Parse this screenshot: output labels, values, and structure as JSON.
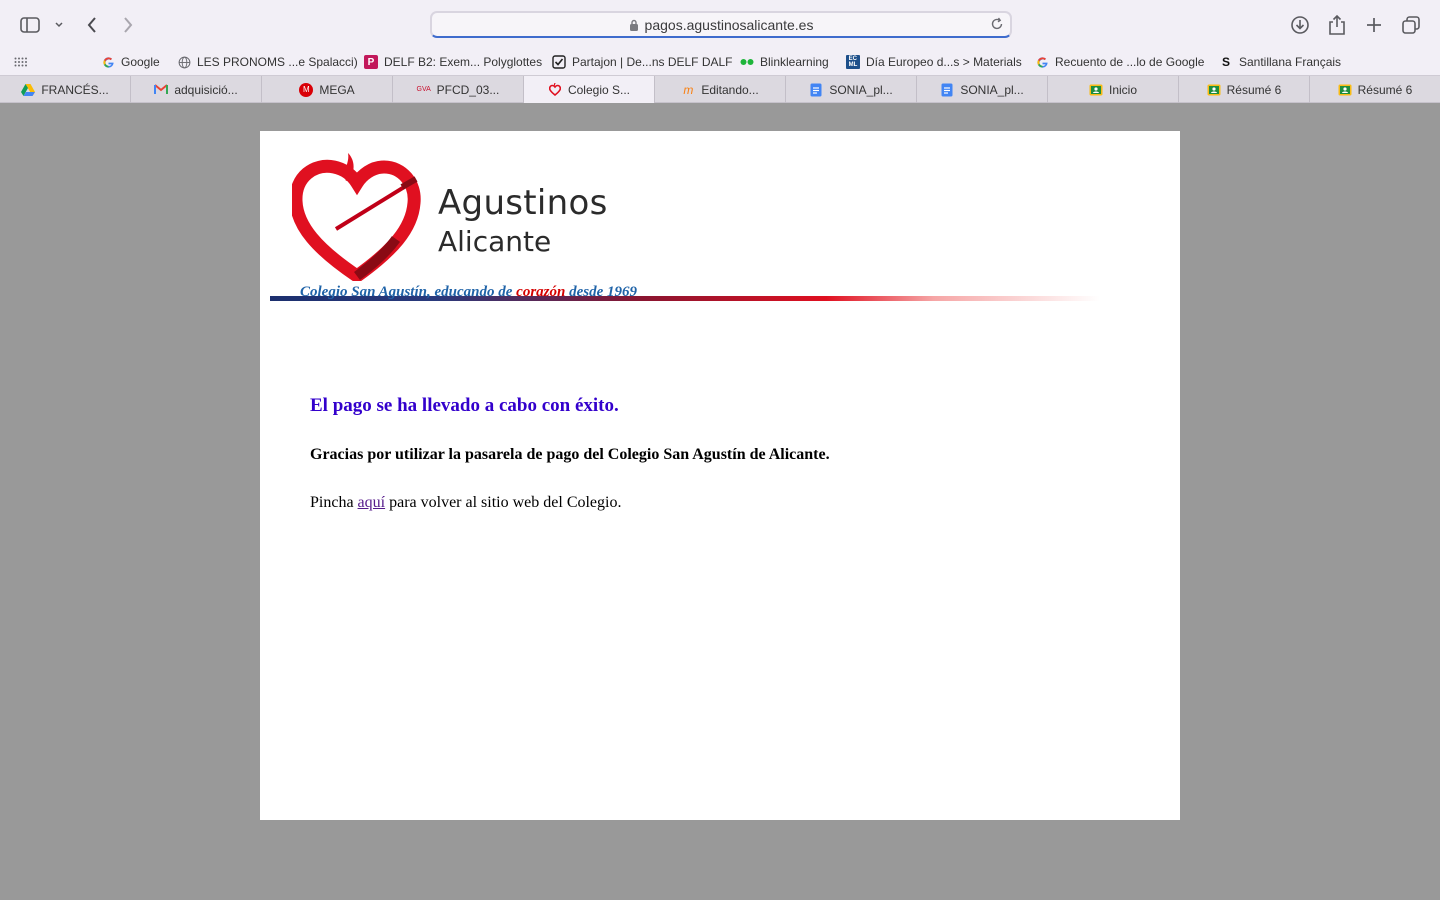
{
  "browser": {
    "url": "pagos.agustinosalicante.es",
    "bookmarks": [
      {
        "label": "Google",
        "icon": "google-icon"
      },
      {
        "label": "LES PRONOMS ...e Spalacci)",
        "icon": "globe-icon"
      },
      {
        "label": "DELF B2: Exem... Polyglottes",
        "icon": "polyglottes-icon"
      },
      {
        "label": "Partajon | De...ns DELF DALF",
        "icon": "checkbox-icon"
      },
      {
        "label": "Blinklearning",
        "icon": "blinklearning-icon"
      },
      {
        "label": "Día Europeo d...s > Materials",
        "icon": "ecml-icon"
      },
      {
        "label": "Recuento de ...lo de Google",
        "icon": "google-icon"
      },
      {
        "label": "Santillana Français",
        "icon": "santillana-icon"
      }
    ],
    "tabs": [
      {
        "label": "FRANCÉS...",
        "icon": "google-drive-icon"
      },
      {
        "label": "adquisició...",
        "icon": "gmail-icon"
      },
      {
        "label": "MEGA",
        "icon": "mega-icon"
      },
      {
        "label": "PFCD_03...",
        "icon": "gva-icon"
      },
      {
        "label": "Colegio S...",
        "icon": "agustinos-icon",
        "active": true
      },
      {
        "label": "Editando...",
        "icon": "moodle-icon"
      },
      {
        "label": "SONIA_pl...",
        "icon": "google-docs-icon"
      },
      {
        "label": "SONIA_pl...",
        "icon": "google-docs-icon"
      },
      {
        "label": "Inicio",
        "icon": "google-classroom-icon"
      },
      {
        "label": "Résumé 6",
        "icon": "google-classroom-icon"
      },
      {
        "label": "Résumé 6",
        "icon": "google-classroom-icon"
      }
    ]
  },
  "page": {
    "logo": {
      "line1": "Agustinos",
      "line2": "Alicante"
    },
    "tagline": {
      "part1": "Colegio San Agustín, educando de ",
      "highlight": "corazón",
      "part2": " desde 1969"
    },
    "success_message": "El pago se ha llevado a cabo con éxito.",
    "thanks_message": "Gracias por utilizar la pasarela de pago del Colegio San Agustín de Alicante.",
    "back_prefix": "Pincha ",
    "back_link": "aquí",
    "back_suffix": " para volver al sitio web del Colegio."
  },
  "colors": {
    "success": "#3300cc",
    "tagline_blue": "#1f63a8",
    "brand_red": "#e01020"
  }
}
